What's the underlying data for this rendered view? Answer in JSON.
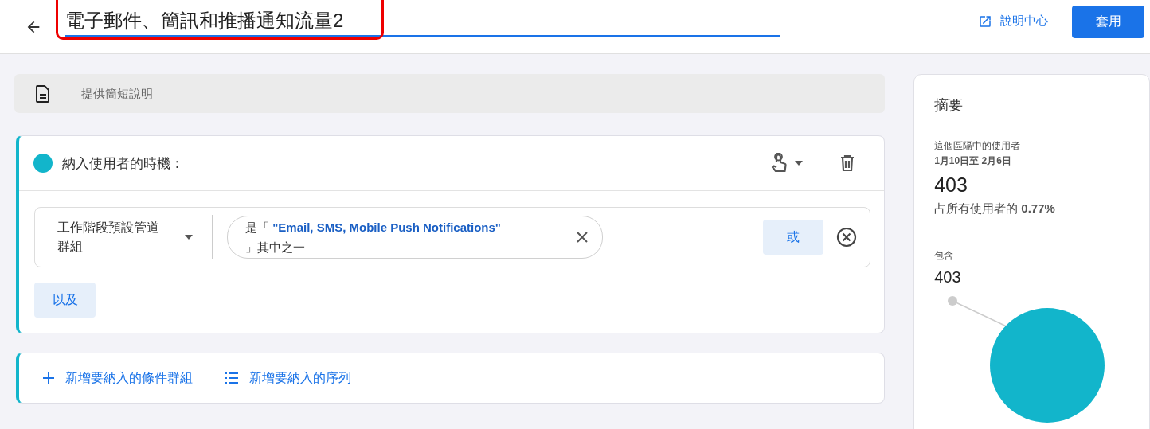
{
  "header": {
    "title": "電子郵件、簡訊和推播通知流量2",
    "title_highlighted": true,
    "help_link": "說明中心",
    "apply_button": "套用"
  },
  "description": {
    "placeholder": "提供簡短說明"
  },
  "include_card": {
    "title": "納入使用者的時機：",
    "color": "#12b5cb",
    "condition": {
      "dimension": "工作階段預設管道群組",
      "prefix": "是「",
      "value": "\"Email, SMS, Mobile Push Notifications\"",
      "suffix": "」其中之一",
      "or_button": "或"
    },
    "and_button": "以及"
  },
  "add_bar": {
    "add_group": "新增要納入的條件群組",
    "add_sequence": "新增要納入的序列"
  },
  "summary": {
    "title": "摘要",
    "users_label": "這個區隔中的使用者",
    "date_range": "1月10日至 2月6日",
    "users": "403",
    "share_prefix": "占所有使用者的",
    "share": "0.77%",
    "includes_label": "包含",
    "includes": "403"
  }
}
